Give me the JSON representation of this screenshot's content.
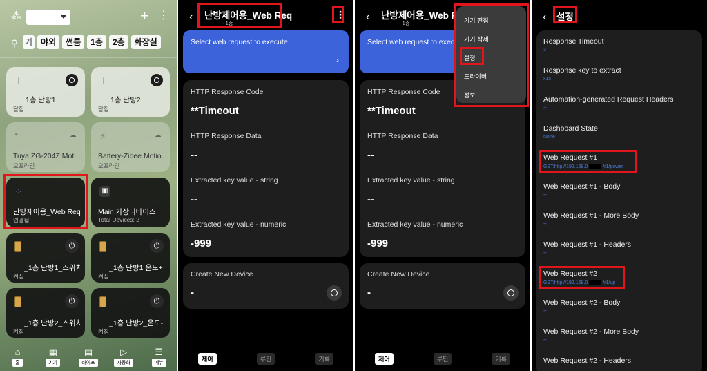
{
  "colors": {
    "accent_blue": "#3d63db",
    "highlight_red": "#e0161c",
    "card_dark": "#1e1e1e",
    "value_blue": "#4b7bd9"
  },
  "phone1": {
    "chips": [
      "기",
      "야외",
      "썬룸",
      "1층",
      "2층",
      "화장실"
    ],
    "cards": [
      {
        "title": "1층 난방1",
        "sub": "닫힘"
      },
      {
        "title": "1층 난방2",
        "sub": "닫힘"
      },
      {
        "title": "Tuya ZG-204Z Motio...",
        "sub": "오프라인"
      },
      {
        "title": "Battery-Zibee Motio...",
        "sub": "오프라인"
      },
      {
        "title": "난방제어용_Web Req",
        "sub": "연결됨"
      },
      {
        "title": "Main 가상디바이스",
        "sub": "Total Devices: 2"
      },
      {
        "title": "_1층 난방1_스위치",
        "sub": "켜짐"
      },
      {
        "title": "_1층 난방1 온도+",
        "sub": "켜짐"
      },
      {
        "title": "_1층 난방2_스위치",
        "sub": "켜짐"
      },
      {
        "title": "_1층 난방2_온도-",
        "sub": "켜짐"
      }
    ],
    "tabs": [
      "홈",
      "기기",
      "라이프",
      "자동화",
      "메뉴"
    ]
  },
  "device": {
    "title": "난방제어용_Web Req",
    "subtitle": "- 1층",
    "blue_label": "Select web request to execute",
    "fields": [
      {
        "label": "HTTP Response Code",
        "value": "**Timeout"
      },
      {
        "label": "HTTP Response Data",
        "value": "--"
      },
      {
        "label": "Extracted key value - string",
        "value": "--"
      },
      {
        "label": "Extracted key value - numeric",
        "value": "-999"
      }
    ],
    "create_label": "Create New Device",
    "create_value": "-",
    "bottom_tabs": [
      "제어",
      "루틴",
      "기록"
    ]
  },
  "menu": {
    "items": [
      "기기 편집",
      "기기 삭제",
      "설정",
      "드라이버",
      "정보"
    ]
  },
  "settings": {
    "title": "설정",
    "items": [
      {
        "title": "Response Timeout",
        "value": "3"
      },
      {
        "title": "Response key to extract",
        "value": "x1x"
      },
      {
        "title": "Automation-generated Request Headers",
        "value": "--"
      },
      {
        "title": "Dashboard State",
        "value": "None"
      },
      {
        "title": "Web Request #1",
        "value_pre": "GET:http://192.168.0",
        "value_post": "/r1/power"
      },
      {
        "title": "Web Request #1 - Body",
        "value": "--"
      },
      {
        "title": "Web Request #1 - More Body",
        "value": "--"
      },
      {
        "title": "Web Request #1 - Headers",
        "value": "--"
      },
      {
        "title": "Web Request #2",
        "value_pre": "GET:http://192.168.0",
        "value_post": "/r1/up"
      },
      {
        "title": "Web Request #2 - Body",
        "value": "--"
      },
      {
        "title": "Web Request #2 - More Body",
        "value": "--"
      },
      {
        "title": "Web Request #2 - Headers",
        "value": ""
      }
    ]
  }
}
